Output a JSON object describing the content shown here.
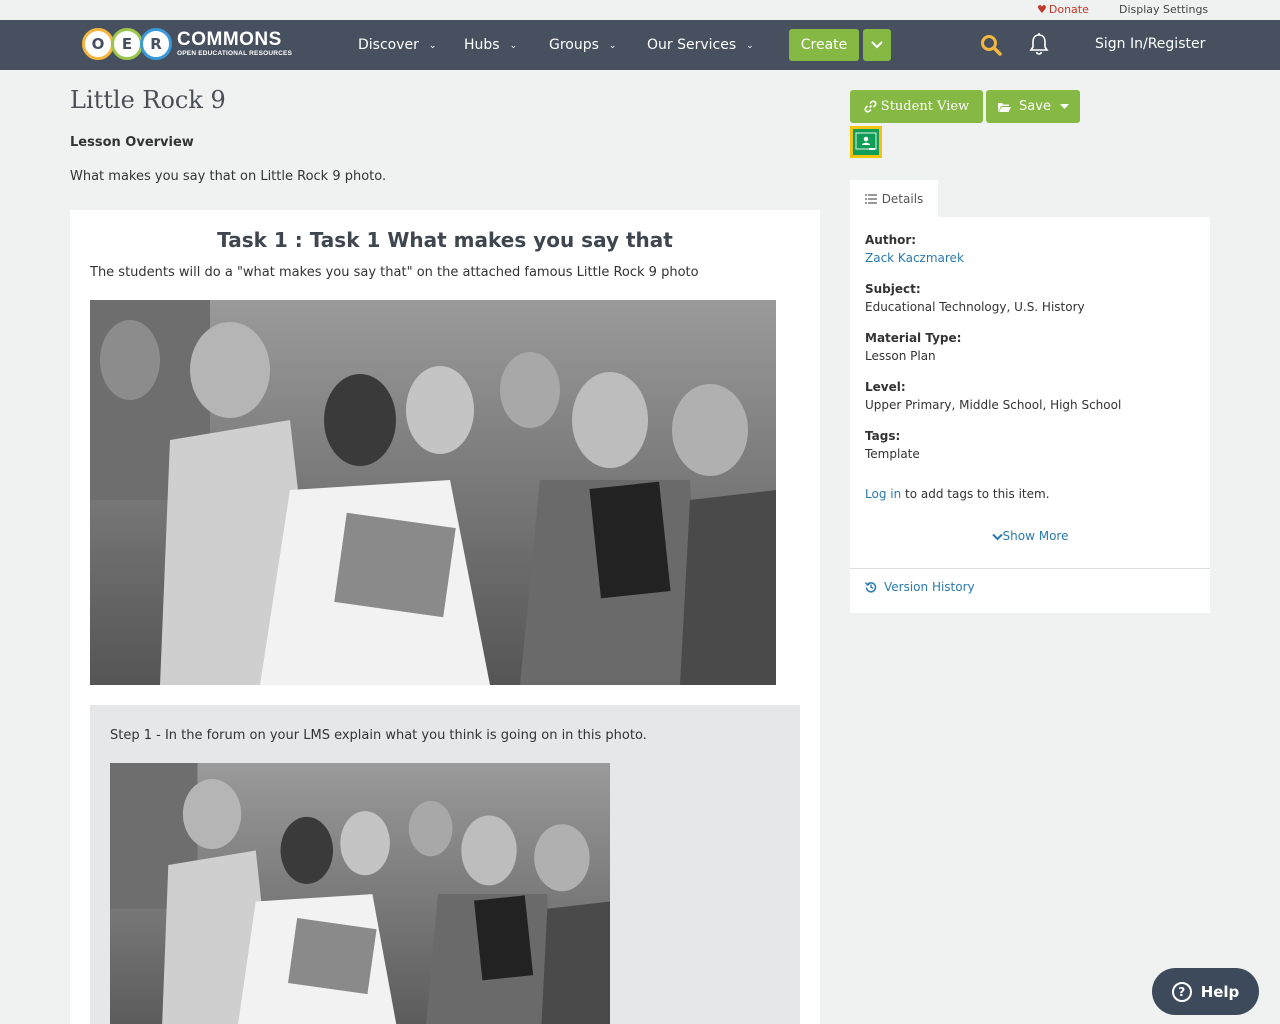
{
  "utility": {
    "donate": "Donate",
    "display_settings": "Display Settings"
  },
  "header": {
    "logo_letters": [
      "O",
      "E",
      "R"
    ],
    "logo_main": "COMMONS",
    "logo_sub": "OPEN EDUCATIONAL RESOURCES",
    "nav": {
      "discover": "Discover",
      "hubs": "Hubs",
      "groups": "Groups",
      "services": "Our Services"
    },
    "create": "Create",
    "sign_in": "Sign In/Register"
  },
  "main": {
    "title": "Little Rock 9",
    "overview_heading": "Lesson Overview",
    "overview_text": "What makes you say that on Little Rock 9 photo.",
    "task_title": "Task 1 : Task 1 What makes you say that",
    "task_desc": "The students will do a \"what makes you say that\" on the attached famous Little Rock 9 photo",
    "step_text": "Step 1 - In the forum on your LMS explain what you think is going on in this photo."
  },
  "sidebar": {
    "student_view": "Student View",
    "save": "Save",
    "details_tab": "Details",
    "author_label": "Author:",
    "author": "Zack Kaczmarek",
    "subject_label": "Subject:",
    "subject": "Educational Technology, U.S. History",
    "material_label": "Material Type:",
    "material": "Lesson Plan",
    "level_label": "Level:",
    "level": "Upper Primary, Middle School, High School",
    "tags_label": "Tags:",
    "tags": "Template",
    "login_link": "Log in",
    "login_rest": " to add tags to this item.",
    "show_more": "Show More",
    "version_history": "Version History"
  },
  "help": {
    "label": "Help"
  },
  "colors": {
    "header_bg": "#46505f",
    "accent_green": "#86b944",
    "link": "#2a7ab0",
    "donate_red": "#c0392b"
  }
}
